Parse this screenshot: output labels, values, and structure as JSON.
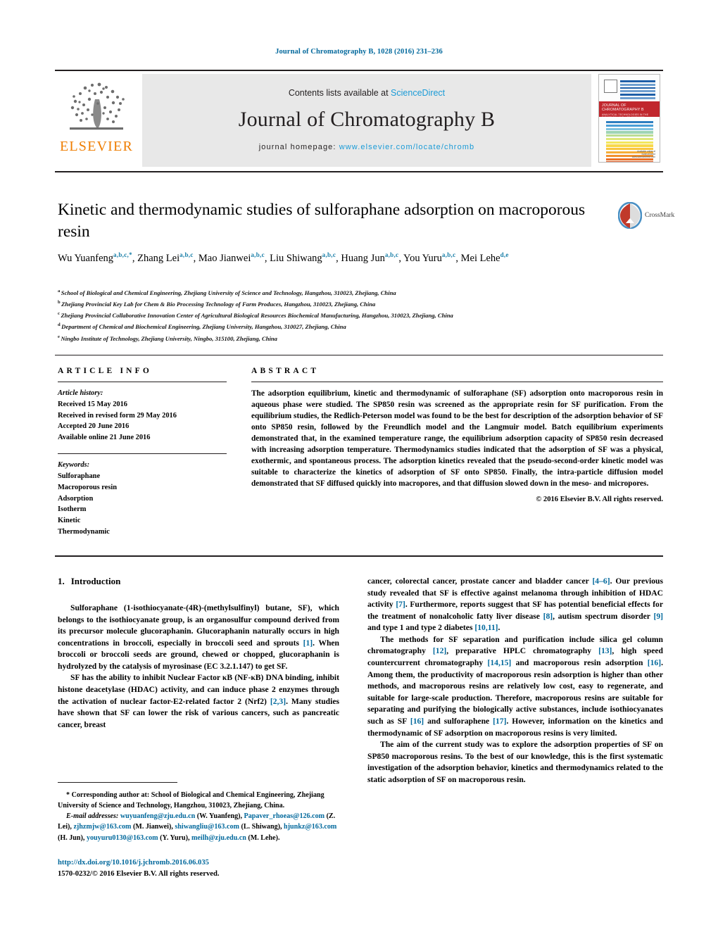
{
  "header": {
    "citation": "Journal of Chromatography B, 1028 (2016) 231–236",
    "contents_prefix": "Contents lists available at ",
    "contents_link": "ScienceDirect",
    "journal_title": "Journal of Chromatography B",
    "homepage_prefix": "journal homepage: ",
    "homepage_url": "www.elsevier.com/locate/chromb",
    "publisher_wordmark": "ELSEVIER",
    "cover": {
      "banner_title": "JOURNAL OF CHROMATOGRAPHY B",
      "banner_sub": "ANALYTICAL TECHNOLOGIES IN THE BIOMEDICAL AND LIFE SCIENCES",
      "foot_line1": "Available online at",
      "foot_line2": "ScienceDirect",
      "foot_line3": "www.sciencedirect.com"
    },
    "accent_blue": "#1a9bd7",
    "link_blue": "#00689c",
    "elsevier_orange": "#ef7d00",
    "cover_red": "#c1272d"
  },
  "article": {
    "title": "Kinetic and thermodynamic studies of sulforaphane adsorption on macroporous resin",
    "crossmark_label": "CrossMark",
    "authors": [
      {
        "name": "Wu Yuanfeng",
        "marks": "a,b,c,*"
      },
      {
        "name": "Zhang Lei",
        "marks": "a,b,c"
      },
      {
        "name": "Mao Jianwei",
        "marks": "a,b,c"
      },
      {
        "name": "Liu Shiwang",
        "marks": "a,b,c"
      },
      {
        "name": "Huang Jun",
        "marks": "a,b,c"
      },
      {
        "name": "You Yuru",
        "marks": "a,b,c"
      },
      {
        "name": "Mei Lehe",
        "marks": "d,e"
      }
    ],
    "affiliations": [
      {
        "marker": "a",
        "text": "School of Biological and Chemical Engineering, Zhejiang University of Science and Technology, Hangzhou, 310023, Zhejiang, China"
      },
      {
        "marker": "b",
        "text": "Zhejiang Provincial Key Lab for Chem & Bio Processing Technology of Farm Produces, Hangzhou, 310023, Zhejiang, China"
      },
      {
        "marker": "c",
        "text": "Zhejiang Provincial Collaborative Innovation Center of Agricultural Biological Resources Biochemical Manufacturing, Hangzhou, 310023, Zhejiang, China"
      },
      {
        "marker": "d",
        "text": "Department of Chemical and Biochemical Engineering, Zhejiang University, Hangzhou, 310027, Zhejiang, China"
      },
      {
        "marker": "e",
        "text": "Ningbo Institute of Technology, Zhejiang University, Ningbo, 315100, Zhejiang, China"
      }
    ]
  },
  "article_info": {
    "heading": "ARTICLE INFO",
    "history_label": "Article history:",
    "history": [
      "Received 15 May 2016",
      "Received in revised form 29 May 2016",
      "Accepted 20 June 2016",
      "Available online 21 June 2016"
    ],
    "keywords_label": "Keywords:",
    "keywords": [
      "Sulforaphane",
      "Macroporous resin",
      "Adsorption",
      "Isotherm",
      "Kinetic",
      "Thermodynamic"
    ]
  },
  "abstract": {
    "heading": "ABSTRACT",
    "body": "The adsorption equilibrium, kinetic and thermodynamic of sulforaphane (SF) adsorption onto macroporous resin in aqueous phase were studied. The SP850 resin was screened as the appropriate resin for SF purification. From the equilibrium studies, the Redlich-Peterson model was found to be the best for description of the adsorption behavior of SF onto SP850 resin, followed by the Freundlich model and the Langmuir model. Batch equilibrium experiments demonstrated that, in the examined temperature range, the equilibrium adsorption capacity of SP850 resin decreased with increasing adsorption temperature. Thermodynamics studies indicated that the adsorption of SF was a physical, exothermic, and spontaneous process. The adsorption kinetics revealed that the pseudo-second-order kinetic model was suitable to characterize the kinetics of adsorption of SF onto SP850. Finally, the intra-particle diffusion model demonstrated that SF diffused quickly into macropores, and that diffusion slowed down in the meso- and micropores.",
    "copyright": "© 2016 Elsevier B.V. All rights reserved."
  },
  "introduction": {
    "number": "1.",
    "heading": "Introduction",
    "left_paragraphs": [
      "Sulforaphane (1-isothiocyanate-(4R)-(methylsulfinyl) butane, SF), which belongs to the isothiocyanate group, is an organosulfur compound derived from its precursor molecule glucoraphanin. Glucoraphanin naturally occurs in high concentrations in broccoli, especially in broccoli seed and sprouts [1]. When broccoli or broccoli seeds are ground, chewed or chopped, glucoraphanin is hydrolyzed by the catalysis of myrosinase (EC 3.2.1.147) to get SF.",
      "SF has the ability to inhibit Nuclear Factor κB (NF-κB) DNA binding, inhibit histone deacetylase (HDAC) activity, and can induce phase 2 enzymes through the activation of nuclear factor-E2-related factor 2 (Nrf2) [2,3]. Many studies have shown that SF can lower the risk of various cancers, such as pancreatic cancer, breast"
    ],
    "right_paragraphs": [
      "cancer, colorectal cancer, prostate cancer and bladder cancer [4–6]. Our previous study revealed that SF is effective against melanoma through inhibition of HDAC activity [7]. Furthermore, reports suggest that SF has potential beneficial effects for the treatment of nonalcoholic fatty liver disease [8], autism spectrum disorder [9] and type 1 and type 2 diabetes [10,11].",
      "The methods for SF separation and purification include silica gel column chromatography [12], preparative HPLC chromatography [13], high speed countercurrent chromatography [14,15] and macroporous resin adsorption [16]. Among them, the productivity of macroporous resin adsorption is higher than other methods, and macroporous resins are relatively low cost, easy to regenerate, and suitable for large-scale production. Therefore, macroporous resins are suitable for separating and purifying the biologically active substances, include isothiocyanates such as SF [16] and sulforaphene [17]. However, information on the kinetics and thermodynamic of SF adsorption on macroporous resins is very limited.",
      "The aim of the current study was to explore the adsorption properties of SF on SP850 macroporous resins. To the best of our knowledge, this is the first systematic investigation of the adsorption behavior, kinetics and thermodynamics related to the static adsorption of SF on macroporous resin."
    ]
  },
  "footnotes": {
    "corresponding": "* Corresponding author at: School of Biological and Chemical Engineering, Zhejiang University of Science and Technology, Hangzhou, 310023, Zhejiang, China.",
    "email_label": "E-mail addresses:",
    "emails": [
      {
        "address": "wuyuanfeng@zju.edu.cn",
        "person": "(W. Yuanfeng)"
      },
      {
        "address": "Papaver_rhoeas@126.com",
        "person": "(Z. Lei)"
      },
      {
        "address": "zjhzmjw@163.com",
        "person": "(M. Jianwei)"
      },
      {
        "address": "shiwangliu@163.com",
        "person": "(L. Shiwang)"
      },
      {
        "address": "hjunkz@163.com",
        "person": "(H. Jun)"
      },
      {
        "address": "youyuru0130@163.com",
        "person": "(Y. Yuru)"
      },
      {
        "address": "meilh@zju.edu.cn",
        "person": "(M. Lehe)"
      }
    ],
    "doi": "http://dx.doi.org/10.1016/j.jchromb.2016.06.035",
    "issn_line": "1570-0232/© 2016 Elsevier B.V. All rights reserved."
  }
}
